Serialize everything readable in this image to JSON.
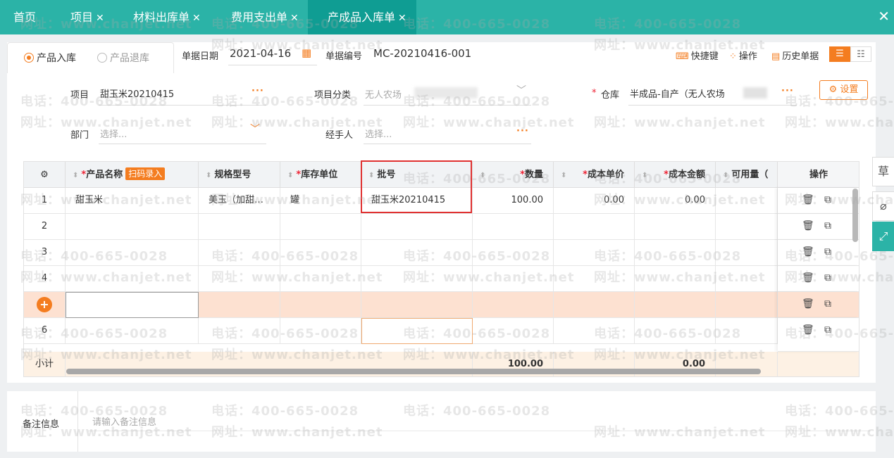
{
  "tabs": [
    {
      "label": "首页",
      "closable": false,
      "active": false
    },
    {
      "label": "项目",
      "closable": true,
      "active": false
    },
    {
      "label": "材料出库单",
      "closable": true,
      "active": false
    },
    {
      "label": "费用支出单",
      "closable": true,
      "active": false
    },
    {
      "label": "产成品入库单",
      "closable": true,
      "active": true
    }
  ],
  "colors": {
    "primary": "#2bb3a7",
    "accent": "#f47d20",
    "highlight_row": "#fde1d1",
    "subtotal_row": "#fdf1e4",
    "selected_cell_border": "#e03131"
  },
  "header": {
    "radio_in": "产品入库",
    "radio_out": "产品退库",
    "date_label": "单据日期",
    "date_value": "2021-04-16",
    "code_label": "单据编号",
    "code_value": "MC-20210416-001",
    "shortcut": "快捷键",
    "operate": "操作",
    "history": "历史单据"
  },
  "form": {
    "project_label": "项目",
    "project_value": "甜玉米20210415",
    "category_label": "项目分类",
    "category_value": "无人农场",
    "warehouse_label": "仓库",
    "warehouse_value": "半成品-自产（无人农场",
    "settings": "设置",
    "dept_label": "部门",
    "dept_placeholder": "选择...",
    "handler_label": "经手人",
    "handler_placeholder": "选择..."
  },
  "table": {
    "columns": [
      "产品名称",
      "规格型号",
      "库存单位",
      "批号",
      "数量",
      "成本单价",
      "成本金额",
      "可用量（",
      "操作"
    ],
    "scan_label": "扫码录入",
    "rows": [
      {
        "no": "1",
        "name": "甜玉米",
        "spec": "美玉（加甜…",
        "unit": "罐",
        "batch": "甜玉米20210415",
        "qty": "100.00",
        "price": "0.00",
        "amount": "0.00"
      },
      {
        "no": "2"
      },
      {
        "no": "3"
      },
      {
        "no": "4"
      },
      {
        "no": "+"
      },
      {
        "no": "6"
      }
    ],
    "subtotal_label": "小计",
    "subtotal_qty": "100.00",
    "subtotal_amount": "0.00"
  },
  "side": {
    "draft": "草"
  },
  "remark": {
    "label": "备注信息",
    "placeholder": "请输入备注信息"
  },
  "watermark": {
    "phone": "电话：400-665-0028",
    "site": "网址：www.chanjet.net"
  }
}
